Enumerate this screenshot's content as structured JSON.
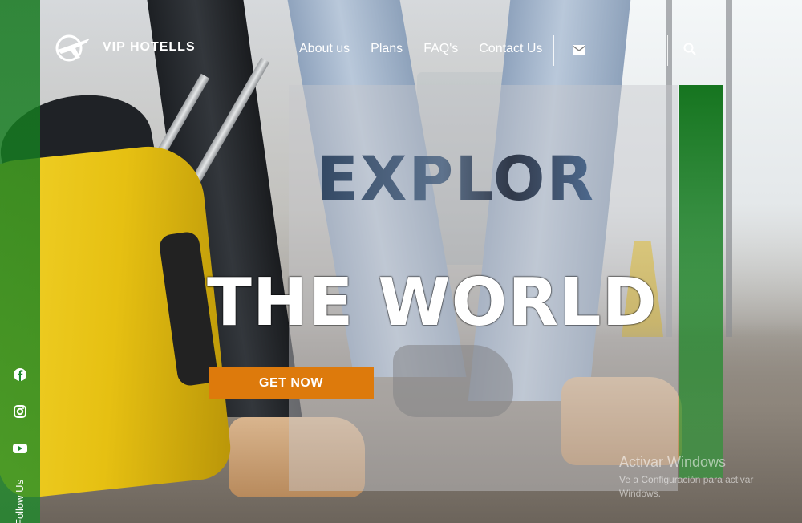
{
  "header": {
    "logo_text": "VIP HOTELLS",
    "nav": [
      "About us",
      "Plans",
      "FAQ's",
      "Contact Us"
    ]
  },
  "hero": {
    "line1": "EXPLOR",
    "line2": "THE WORLD",
    "cta_label": "GET NOW"
  },
  "social": {
    "icons": [
      "facebook-icon",
      "instagram-icon",
      "youtube-icon"
    ],
    "label": "Follow Us"
  },
  "watermark": {
    "title": "Activar Windows",
    "subtitle": "Ve a Configuración para activar Windows."
  },
  "colors": {
    "accent": "#dd7a0c",
    "green_band": "#1b8a2c"
  }
}
